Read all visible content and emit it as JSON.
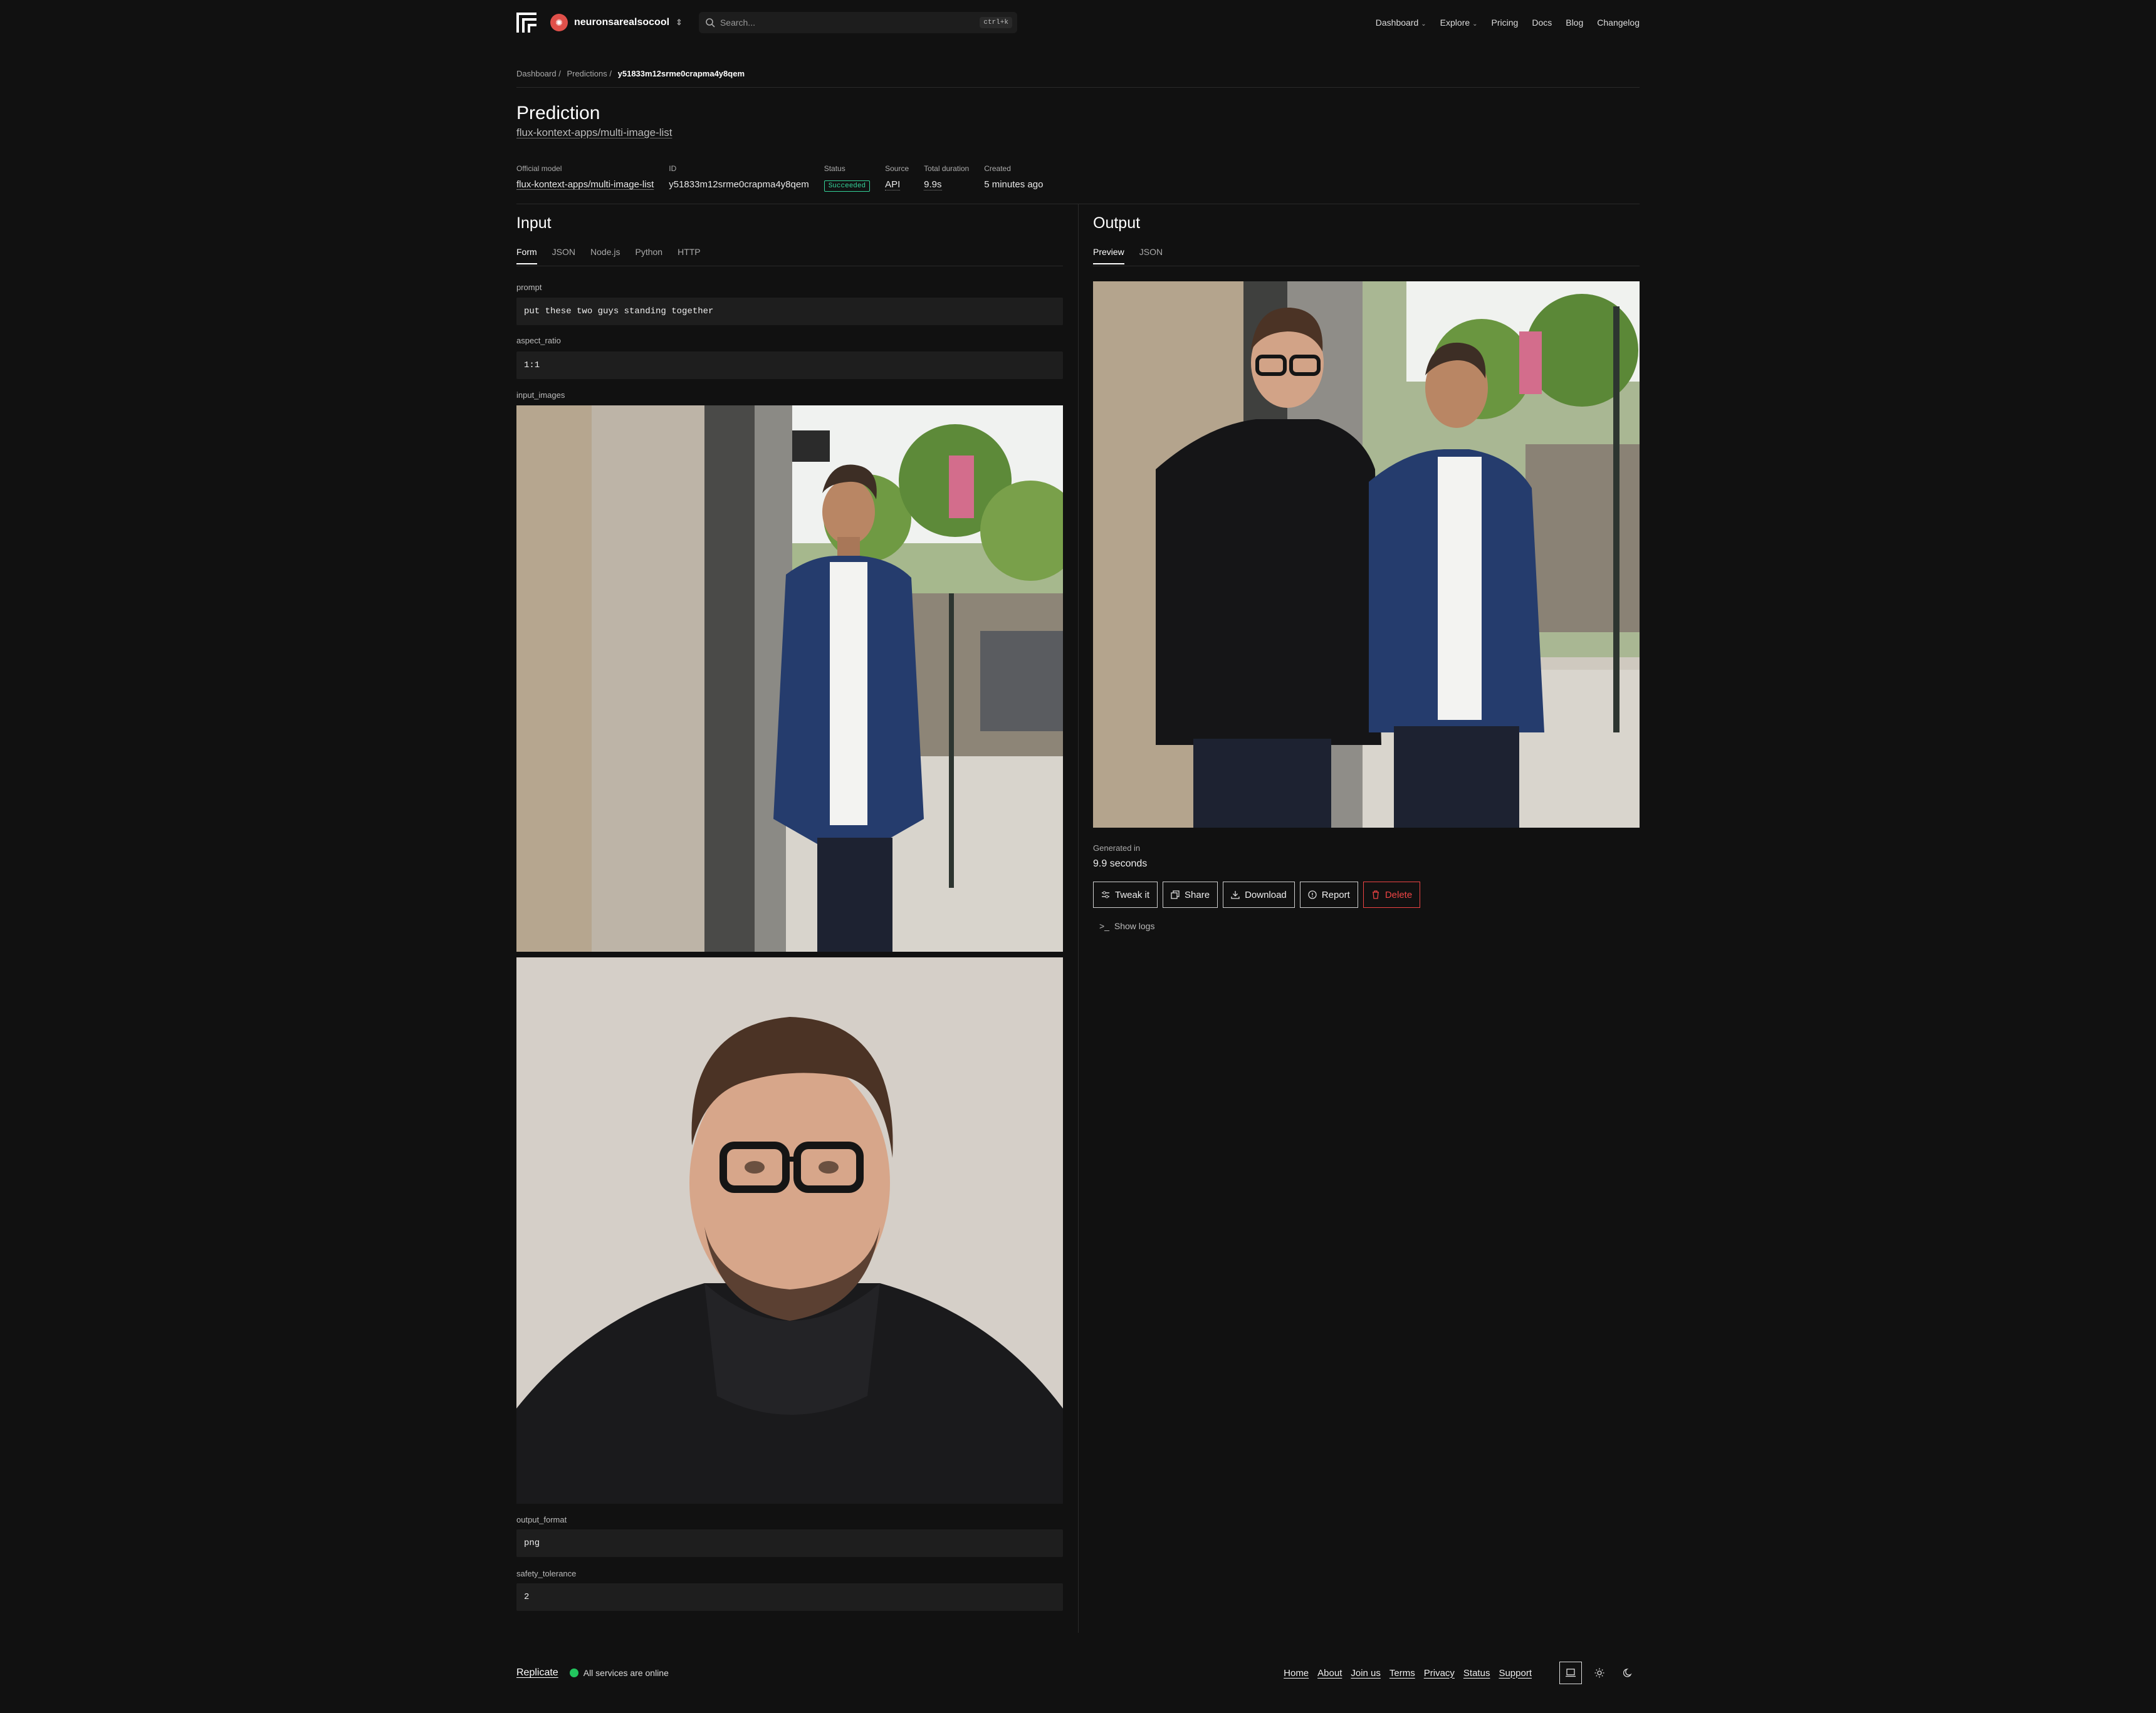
{
  "header": {
    "account_name": "neuronsarealsocool",
    "search_placeholder": "Search...",
    "search_shortcut": "ctrl+k",
    "nav": [
      "Dashboard",
      "Explore",
      "Pricing",
      "Docs",
      "Blog",
      "Changelog"
    ]
  },
  "breadcrumb": {
    "items": [
      "Dashboard /",
      "Predictions /"
    ],
    "current": "y51833m12srme0crapma4y8qem"
  },
  "page": {
    "title": "Prediction",
    "subtitle": "flux-kontext-apps/multi-image-list"
  },
  "meta": {
    "official_model_label": "Official model",
    "official_model": "flux-kontext-apps/multi-image-list",
    "id_label": "ID",
    "id": "y51833m12srme0crapma4y8qem",
    "status_label": "Status",
    "status": "Succeeded",
    "source_label": "Source",
    "source": "API",
    "duration_label": "Total duration",
    "duration": "9.9s",
    "created_label": "Created",
    "created": "5 minutes ago"
  },
  "input": {
    "title": "Input",
    "tabs": [
      "Form",
      "JSON",
      "Node.js",
      "Python",
      "HTTP"
    ],
    "fields": {
      "prompt_label": "prompt",
      "prompt": "put these two guys standing together",
      "aspect_label": "aspect_ratio",
      "aspect": "1:1",
      "images_label": "input_images",
      "format_label": "output_format",
      "format": "png",
      "safety_label": "safety_tolerance",
      "safety": "2"
    }
  },
  "output": {
    "title": "Output",
    "tabs": [
      "Preview",
      "JSON"
    ],
    "generated_label": "Generated in",
    "generated_value": "9.9 seconds",
    "buttons": [
      "Tweak it",
      "Share",
      "Download",
      "Report",
      "Delete"
    ],
    "show_logs": "Show logs"
  },
  "footer": {
    "brand": "Replicate",
    "status": "All services are online",
    "links": [
      "Home",
      "About",
      "Join us",
      "Terms",
      "Privacy",
      "Status",
      "Support"
    ]
  },
  "colors": {
    "background": "#111111",
    "success": "#34d399",
    "danger": "#ef4444",
    "online": "#22c55e"
  }
}
